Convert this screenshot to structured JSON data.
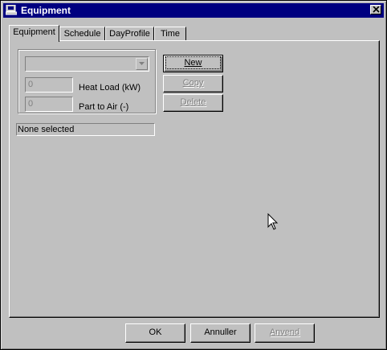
{
  "window": {
    "title": "Equipment"
  },
  "tabs": [
    {
      "label": "Equipment",
      "active": true
    },
    {
      "label": "Schedule",
      "active": false
    },
    {
      "label": "DayProfile",
      "active": false
    },
    {
      "label": "Time",
      "active": false
    }
  ],
  "form": {
    "equipment_select": {
      "value": ""
    },
    "heat_load": {
      "value": "0",
      "label": "Heat Load (kW)"
    },
    "part_to_air": {
      "value": "0",
      "label": "Part to Air (-)"
    },
    "status": "None selected"
  },
  "side_buttons": {
    "new": "New",
    "copy": "Copy",
    "delete": "Delete"
  },
  "dialog_buttons": {
    "ok": "OK",
    "cancel": "Annuller",
    "apply": "Anvend"
  },
  "icons": {
    "app": "computer-icon",
    "close": "close-icon",
    "dropdown": "chevron-down-icon",
    "cursor": "mouse-pointer-icon"
  },
  "colors": {
    "title_bar": "#000080",
    "face": "#c0c0c0",
    "disabled_text": "#808080"
  }
}
